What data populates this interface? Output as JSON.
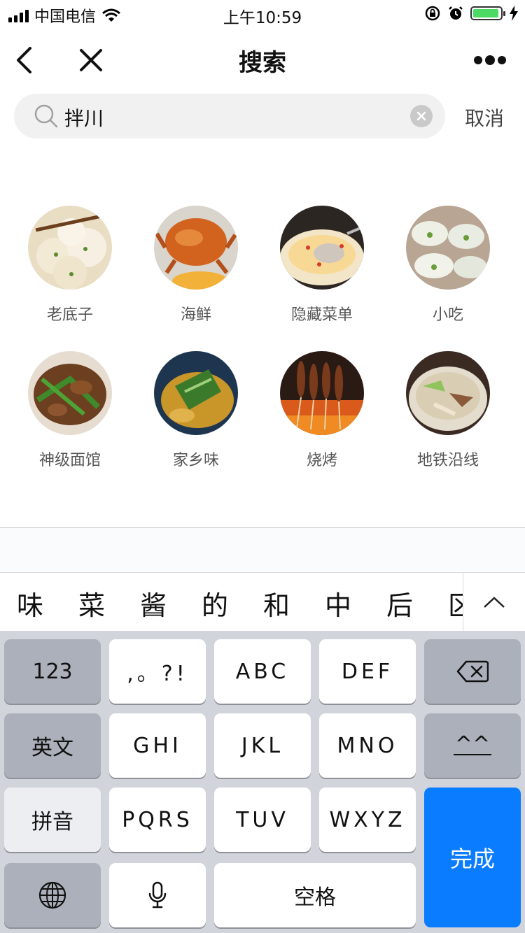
{
  "status_bar": {
    "carrier": "中国电信",
    "time": "上午10:59",
    "battery_level": 0.95,
    "icons": [
      "signal-icon",
      "wifi-icon",
      "rotation-lock-icon",
      "alarm-icon",
      "battery-icon",
      "charging-icon"
    ]
  },
  "nav": {
    "title": "搜索",
    "back_icon": "back-icon",
    "close_icon": "close-icon",
    "more_icon": "more-icon"
  },
  "search": {
    "value": "拌川",
    "cancel_label": "取消",
    "icons": [
      "search-icon",
      "clear-icon"
    ]
  },
  "categories": [
    {
      "label": "老底子"
    },
    {
      "label": "海鲜"
    },
    {
      "label": "隐藏菜单"
    },
    {
      "label": "小吃"
    },
    {
      "label": "神级面馆"
    },
    {
      "label": "家乡味"
    },
    {
      "label": "烧烤"
    },
    {
      "label": "地铁沿线"
    }
  ],
  "keyboard": {
    "candidates": [
      "味",
      "菜",
      "酱",
      "的",
      "和",
      "中",
      "后",
      "区"
    ],
    "keys": {
      "num": "123",
      "punct": ",。?!",
      "abc": "ABC",
      "def": "DEF",
      "english": "英文",
      "ghi": "GHI",
      "jkl": "JKL",
      "mno": "MNO",
      "emoji": "^^",
      "pinyin": "拼音",
      "pqrs": "PQRS",
      "tuv": "TUV",
      "wxyz": "WXYZ",
      "done": "完成",
      "space": "空格"
    },
    "colors": {
      "done_key": "#0a7cff",
      "background": "#d1d4db"
    }
  }
}
